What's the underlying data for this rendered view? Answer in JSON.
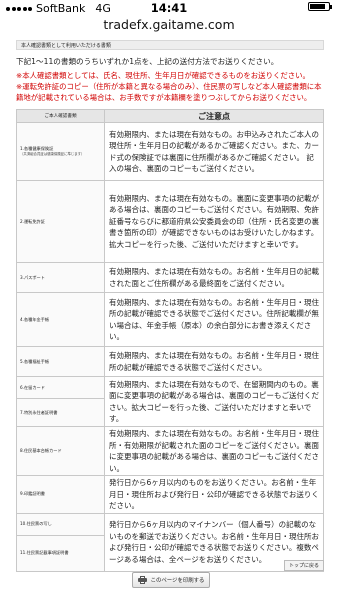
{
  "status_bar": {
    "carrier": "SoftBank",
    "network": "4G",
    "time": "14:41",
    "battery_level": 0.85
  },
  "url": "tradefx.gaitame.com",
  "section_label": "本人確認書類として利用いただける書類",
  "intro": "下記1〜11の書類のうちいずれか1点を、上記の送付方法でお送りください。",
  "notes": [
    "※本人確認書類としては、氏名、現住所、生年月日が確認できるものをお送りください。",
    "※運転免許証のコピー（住所が本籍と異なる場合のみ）、住民票の写しなど本人確認書類に本籍地が記載されている場合は、お手数ですが本籍欄を塗りつぶしてからお送りください。"
  ],
  "table": {
    "col_doc_header": "ご本人確認書類",
    "col_note_header": "ご注意点",
    "rows": [
      {
        "doc": "1.各種健康保険証",
        "sub": "（共済組合員証は健康保険証に準じます）",
        "desc": "有効期限内、または現在有効なもの。お申込みされたご本人の現住所・生年月日の記載があるかご確認ください。また、カード式の保険証では裏面に住所欄があるかご確認ください。 記入の場合、裏面のコピーもご送付ください。"
      },
      {
        "doc": "2.運転免許証",
        "sub": "",
        "desc": "有効期限内、または現在有効なもの。裏面に変更事項の記載がある場合は、裏面のコピーもご送付ください。有効期限、免許証番号ならびに都道府県公安委員会の印（住所・氏名変更の裏書き箇所の印）が確認できないものはお受けいたしかねます。拡大コピーを行った後、ご送付いただけますと幸いです。"
      },
      {
        "doc": "3.パスポート",
        "sub": "",
        "desc": "有効期限内、または現在有効なもの。お名前・生年月日の記載された面とご住所欄がある最終面をご送付ください。"
      },
      {
        "doc": "4.各種年金手帳",
        "sub": "",
        "desc": "有効期限内、または現在有効なもの。お名前・生年月日・現住所の記載が確認できる状態でご送付ください。住所記載欄が無い場合は、年金手帳（原本）の余白部分にお書き添えください。"
      },
      {
        "doc": "5.各種福祉手帳",
        "sub": "",
        "desc": "有効期限内、または現在有効なもの。お名前・生年月日・現住所の記載が確認できる状態でご送付ください。"
      },
      {
        "doc": "6.在留カード",
        "sub": "",
        "desc": "有効期限内、または現在有効なもので、在留期間内のもの。裏面に変更事項の記載がある場合は、裏面のコピーもご送付ください。拡大コピーを行った後、ご送付いただけますと幸いです。"
      },
      {
        "doc": "7.特別永住者証明書",
        "sub": "",
        "desc": ""
      },
      {
        "doc": "8.住民基本台帳カード",
        "sub": "",
        "desc": "有効期限内、または現在有効なもの。お名前・生年月日・現住所・有効期限が記載された面のコピーをご送付ください。裏面に変更事項の記載がある場合は、裏面のコピーもご送付ください。"
      },
      {
        "doc": "9.印鑑証明書",
        "sub": "",
        "desc": "発行日から6ヶ月以内のものをお送りください。お名前・生年月日・現住所および発行日・公印が確認できる状態でお送りください。"
      },
      {
        "doc": "10.住民票の写し",
        "sub": "",
        "desc": "発行日から6ヶ月以内のマイナンバー（個人番号）の記載のないものを郵送でお送りください。お名前・生年月日・現住所および発行日・公印が確認できる状態でお送りください。複数ページある場合は、全ページをお送りください。"
      },
      {
        "doc": "11.住民票記載事項証明書",
        "sub": "",
        "desc": ""
      }
    ]
  },
  "page_top_label": "トップに戻る",
  "print_button_label": "このページを印刷する",
  "icons": {
    "print": "printer-icon",
    "signal": "signal-dots-icon",
    "battery": "battery-icon"
  }
}
